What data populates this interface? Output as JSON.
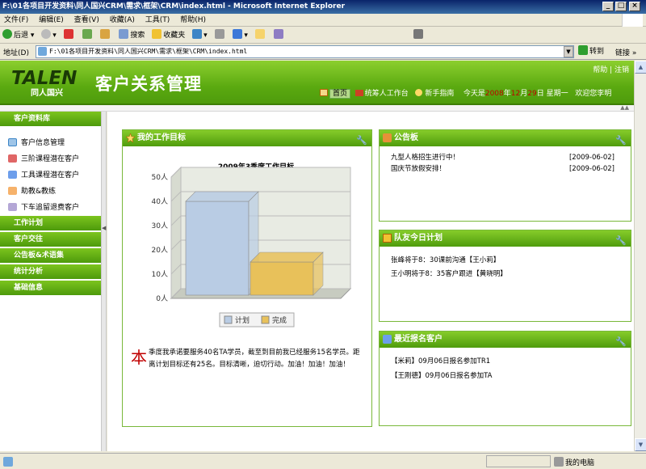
{
  "window": {
    "title": "F:\\01各项目开发资料\\同人国兴CRM\\需求\\框架\\CRM\\index.html - Microsoft Internet Explorer"
  },
  "menu": [
    "文件(F)",
    "编辑(E)",
    "查看(V)",
    "收藏(A)",
    "工具(T)",
    "帮助(H)"
  ],
  "toolbar": {
    "back": "后退",
    "search": "搜索",
    "favorites": "收藏夹"
  },
  "address": {
    "label": "地址(D)",
    "value": "F:\\01各项目开发资料\\同人国兴CRM\\需求\\框架\\CRM\\index.html",
    "go": "转到",
    "links": "链接"
  },
  "header": {
    "logo_text": "TALEN",
    "logo_sub": "同人国兴",
    "title": "客户关系管理",
    "help": "帮助",
    "logout": "注销",
    "nav_home": "首页",
    "nav_workbench": "统筹人工作台",
    "nav_guide": "新手指南",
    "today_prefix": "今天是",
    "year": "2008",
    "year_unit": "年",
    "month": "12",
    "month_unit": "月",
    "day": "29",
    "day_unit": "日",
    "weekday": "星期一",
    "welcome": "欢迎您李明"
  },
  "sidebar": {
    "sections": [
      {
        "label": "客户资料库",
        "items": [
          "客户信息管理",
          "三阶课程潜在客户",
          "工具课程潜在客户",
          "助教&教练",
          "下车追留退费客户"
        ]
      },
      {
        "label": "工作计划"
      },
      {
        "label": "客户交往"
      },
      {
        "label": "公告板&术语集"
      },
      {
        "label": "统计分析"
      },
      {
        "label": "基础信息"
      }
    ]
  },
  "goal_panel": {
    "title": "我的工作目标",
    "drop_cap": "本",
    "text": "季度我承诺要服务40名TA学员，截至到目前我已经服务15名学员。距离计划目标还有25名。目标清晰，迫切行动。加油！加油！加油！"
  },
  "chart_data": {
    "type": "bar",
    "title": "2009年3季度工作目标",
    "categories": [
      ""
    ],
    "series": [
      {
        "name": "计划",
        "values": [
          40
        ],
        "color": "#b9cce4"
      },
      {
        "name": "完成",
        "values": [
          15
        ],
        "color": "#e8c15a"
      }
    ],
    "ylim": [
      0,
      50
    ],
    "yticks": [
      "0人",
      "10人",
      "20人",
      "30人",
      "40人",
      "50人"
    ],
    "legend": "bottom"
  },
  "bulletin": {
    "title": "公告板",
    "items": [
      {
        "text": "九型人格招生进行中！",
        "date": "[2009-06-02]"
      },
      {
        "text": "国庆节放假安排！",
        "date": "[2009-06-02]"
      }
    ]
  },
  "team_plan": {
    "title": "队友今日计划",
    "items": [
      "张峰将于8：30课前沟通【王小莉】",
      "王小明将于8：35客户跟进【黄晓明】"
    ]
  },
  "recent": {
    "title": "最近报名客户",
    "items": [
      "【米莉】09月06日报名参加TR1",
      "【王刚德】09月06日报名参加TA"
    ]
  },
  "status": {
    "zone": "我的电脑"
  },
  "colors": {
    "brand_green": "#5aa910",
    "date_red": "#c00000"
  }
}
